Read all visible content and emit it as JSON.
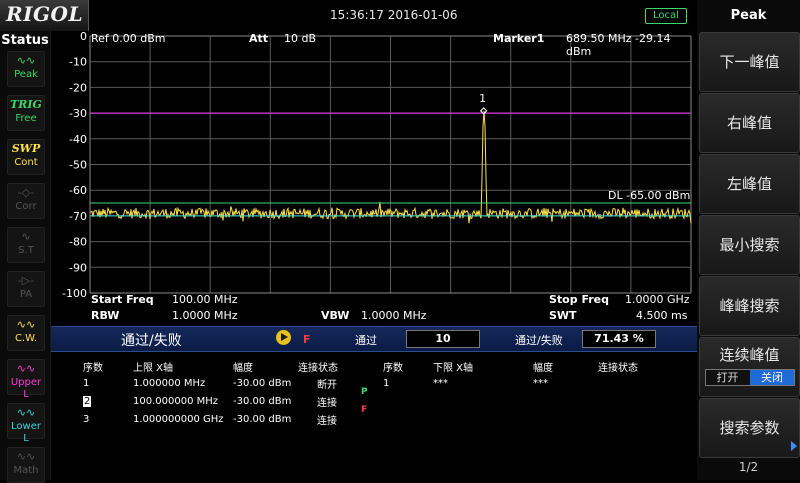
{
  "brand": "RIGOL",
  "clock": "15:36:17 2016-01-06",
  "local_badge": "Local",
  "status": {
    "title": "Status",
    "items": [
      {
        "top": "Peak",
        "bottom": "",
        "color": "#3bd96a",
        "icon": "peak-wave-icon",
        "glyph": "∿∿"
      },
      {
        "top": "TRIG",
        "bottom": "Free",
        "color": "#3bd96a",
        "icon": "",
        "glyph": ""
      },
      {
        "top": "SWP",
        "bottom": "Cont",
        "color": "#ffe14a",
        "icon": "",
        "glyph": ""
      },
      {
        "top": "Corr",
        "bottom": "",
        "color": "#555555",
        "icon": "correction-icon",
        "glyph": "-◇-"
      },
      {
        "top": "S.T",
        "bottom": "",
        "color": "#555555",
        "icon": "signal-track-icon",
        "glyph": "∿"
      },
      {
        "top": "PA",
        "bottom": "",
        "color": "#555555",
        "icon": "preamp-icon",
        "glyph": "-▷-"
      },
      {
        "top": "C.W.",
        "bottom": "",
        "color": "#ffe14a",
        "icon": "channel-wave-icon",
        "glyph": "∿∿"
      },
      {
        "top": "Upper L",
        "bottom": "",
        "color": "#ff3ad6",
        "icon": "upper-limit-icon",
        "glyph": "∿∿"
      },
      {
        "top": "Lower L",
        "bottom": "",
        "color": "#3ad6d6",
        "icon": "lower-limit-icon",
        "glyph": "∿∿"
      },
      {
        "top": "Math",
        "bottom": "",
        "color": "#555555",
        "icon": "math-icon",
        "glyph": "∿∿"
      }
    ]
  },
  "header": {
    "ref": "Ref  0.00 dBm",
    "att_label": "Att",
    "att_value": "10 dB",
    "marker_label": "Marker1",
    "marker_value": "689.50 MHz  -29.14 dBm"
  },
  "chart_data": {
    "type": "line",
    "ylim": [
      -100,
      0
    ],
    "y_ticks": [
      "0",
      "-10",
      "-20",
      "-30",
      "-40",
      "-50",
      "-60",
      "-70",
      "-80",
      "-90",
      "-100"
    ],
    "x_range_mhz": [
      100,
      1000
    ],
    "grid": true,
    "noise_floor_dbm": -69,
    "peak": {
      "freq_mhz": 689.5,
      "level_dbm": -29.14,
      "label": "1"
    },
    "display_line": {
      "label": "DL -65.00 dBm",
      "level_dbm": -65,
      "color": "#3bd96a"
    },
    "reference_line": {
      "level_dbm": -30,
      "color": "#d63ad6"
    },
    "lower_line": {
      "level_dbm": -70,
      "color": "#3ad6d6"
    },
    "trace_color": "#ffe14a"
  },
  "footer": {
    "start_label": "Start Freq",
    "start_value": "100.00 MHz",
    "stop_label": "Stop Freq",
    "stop_value": "1.0000 GHz",
    "rbw_label": "RBW",
    "rbw_value": "1.0000 MHz",
    "vbw_label": "VBW",
    "vbw_value": "1.0000 MHz",
    "swt_label": "SWT",
    "swt_value": "4.500 ms"
  },
  "passfail": {
    "title": "通过/失败",
    "fail_mark": "F",
    "pass_label": "通过",
    "pass_value": "10",
    "ratio_label": "通过/失败",
    "ratio_value": "71.43 %"
  },
  "limit_table": {
    "upper_headers": [
      "序数",
      "上限 X轴",
      "幅度",
      "连接状态"
    ],
    "lower_headers": [
      "序数",
      "下限 X轴",
      "幅度",
      "连接状态"
    ],
    "upper_rows": [
      {
        "idx": "1",
        "x": "1.000000 MHz",
        "amp": "-30.00 dBm",
        "conn": "断开"
      },
      {
        "idx": "2",
        "x": "100.000000 MHz",
        "amp": "-30.00 dBm",
        "conn": "连接"
      },
      {
        "idx": "3",
        "x": "1.000000000 GHz",
        "amp": "-30.00 dBm",
        "conn": "连接"
      }
    ],
    "lower_rows": [
      {
        "idx": "1",
        "x": "***",
        "amp": "***",
        "conn": ""
      }
    ],
    "status_p": "P",
    "status_f": "F"
  },
  "softkeys": {
    "title": "Peak",
    "items": [
      "下一峰值",
      "右峰值",
      "左峰值",
      "最小搜索",
      "峰峰搜索",
      "连续峰值",
      "搜索参数"
    ],
    "toggle_on": "打开",
    "toggle_off": "关闭",
    "page": "1/2"
  }
}
